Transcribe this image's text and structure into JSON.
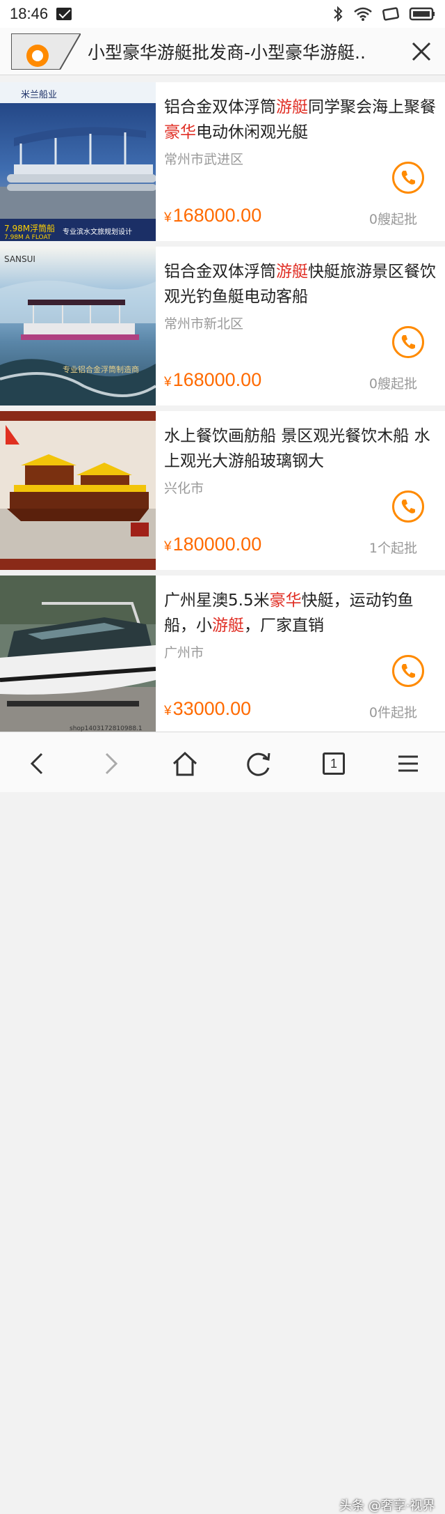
{
  "status_bar": {
    "time": "18:46"
  },
  "header": {
    "title": "小型豪华游艇批发商-小型豪华游艇.."
  },
  "listings": [
    {
      "title_parts": [
        "铝合金双体浮筒",
        "游艇",
        "同学聚会海上聚餐",
        "豪华",
        "电动休闲观光艇"
      ],
      "location": "常州市武进区",
      "price_symbol": "¥",
      "price": "168000.00",
      "min_order": "0艘起批",
      "thumb_text_top": "米兰船业",
      "thumb_text_bottom": "7.98M浮筒船",
      "thumb_text_bottom2": "专业滨水文旅规划设计",
      "thumb_text_bottom3": "7.98M A FLOAT"
    },
    {
      "title_parts": [
        "铝合金双体浮筒",
        "游艇",
        "快艇旅游景区餐饮观光钓鱼艇电动客船",
        "",
        ""
      ],
      "location": "常州市新北区",
      "price_symbol": "¥",
      "price": "168000.00",
      "min_order": "0艘起批",
      "thumb_text_top": "SANSUI",
      "thumb_text_bottom": "专业铝合金浮筒制造商"
    },
    {
      "title_parts": [
        "水上餐饮画舫船 景区观光餐饮木船 水上观光大游船玻璃钢大",
        "",
        "",
        "",
        ""
      ],
      "location": "兴化市",
      "price_symbol": "¥",
      "price": "180000.00",
      "min_order": "1个起批"
    },
    {
      "title_parts": [
        "广州星澳5.5米",
        "豪华",
        "快艇，运动钓鱼船，小",
        "游艇",
        "，厂家直销"
      ],
      "location": "广州市",
      "price_symbol": "¥",
      "price": "33000.00",
      "min_order": "0件起批",
      "thumb_text_bottom": "shop1403172810988.1"
    }
  ],
  "bottom_bar": {
    "tab_count": "1",
    "watermark": "头条 @奢享·视界"
  },
  "colors": {
    "accent": "#ff8a00",
    "price": "#ff6a00",
    "highlight": "#e02e24"
  },
  "icons": [
    "bluetooth-icon",
    "wifi-icon",
    "screen-rotate-icon",
    "battery-icon",
    "close-icon",
    "phone-icon",
    "back-icon",
    "forward-icon",
    "home-icon",
    "refresh-icon",
    "tabs-icon",
    "menu-icon"
  ]
}
